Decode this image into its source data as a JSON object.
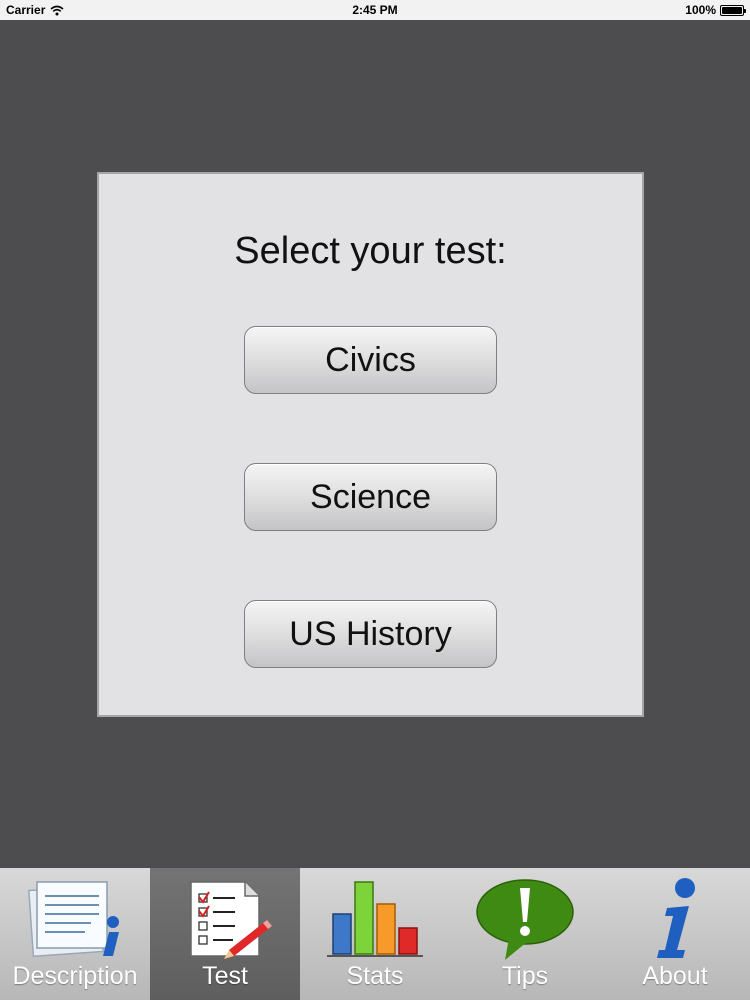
{
  "status_bar": {
    "carrier": "Carrier",
    "time": "2:45 PM",
    "battery": "100%",
    "battery_level": 1.0
  },
  "panel": {
    "title": "Select your test:",
    "buttons": [
      {
        "label": "Civics"
      },
      {
        "label": "Science"
      },
      {
        "label": "US History"
      }
    ]
  },
  "tab_bar": {
    "selected": "Test",
    "tabs": [
      {
        "label": "Description",
        "icon": "description-icon"
      },
      {
        "label": "Test",
        "icon": "checklist-icon"
      },
      {
        "label": "Stats",
        "icon": "bar-chart-icon"
      },
      {
        "label": "Tips",
        "icon": "tips-bubble-icon"
      },
      {
        "label": "About",
        "icon": "info-icon"
      }
    ]
  },
  "colors": {
    "background": "#4d4c4f",
    "panel": "#e2e1e4",
    "tab_selected": "#686868",
    "tab_bar": "#c8c8c8"
  }
}
